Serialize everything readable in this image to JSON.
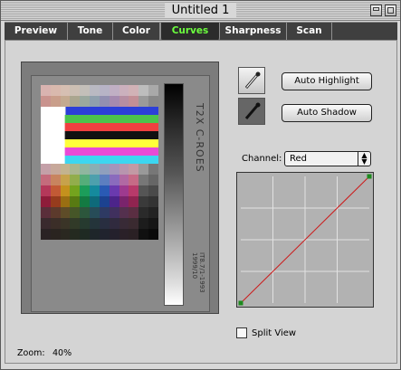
{
  "window": {
    "title": "Untitled 1"
  },
  "tabs": [
    {
      "label": "Preview",
      "active": false
    },
    {
      "label": "Tone",
      "active": false
    },
    {
      "label": "Color",
      "active": false
    },
    {
      "label": "Curves",
      "active": true
    },
    {
      "label": "Sharpness",
      "active": false
    },
    {
      "label": "Scan",
      "active": false
    }
  ],
  "tools": {
    "highlight_icon": "eyedropper-white-icon",
    "shadow_icon": "eyedropper-black-icon",
    "auto_highlight_label": "Auto Highlight",
    "auto_shadow_label": "Auto Shadow"
  },
  "channel": {
    "label": "Channel:",
    "selected": "Red"
  },
  "curve": {
    "points": [
      [
        0,
        0
      ],
      [
        255,
        255
      ]
    ],
    "grid_divisions": 4,
    "line_color": "#cc1a1a",
    "point_color": "#1e8a1e"
  },
  "split_view": {
    "label": "Split View",
    "checked": false
  },
  "zoom": {
    "label": "Zoom:",
    "value": "40%"
  },
  "preview": {
    "target_text": "T2X   C-ROES",
    "target_small_text": "IT8.7/1-1993 1999/10"
  },
  "colors": {
    "tab_active_text": "#6cff3e",
    "tab_bar_bg": "#3f3f3f"
  }
}
